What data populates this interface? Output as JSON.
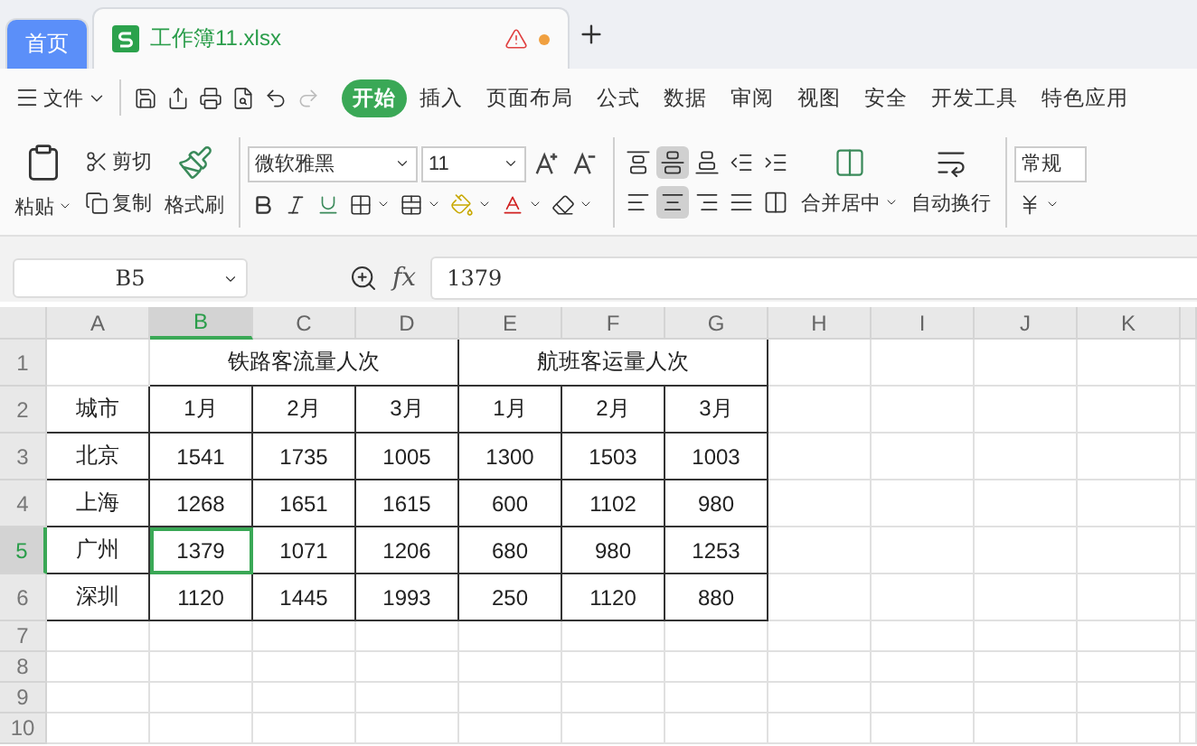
{
  "doc_tabs": [
    {
      "label": "首页",
      "selected": false,
      "kind": "home"
    },
    {
      "label": "工作簿11.xlsx",
      "selected": true,
      "kind": "file",
      "unsaved": true
    }
  ],
  "menu": {
    "file": "文件",
    "tabs": [
      {
        "label": "开始",
        "selected": true
      },
      {
        "label": "插入",
        "selected": false
      },
      {
        "label": "页面布局",
        "selected": false
      },
      {
        "label": "公式",
        "selected": false
      },
      {
        "label": "数据",
        "selected": false
      },
      {
        "label": "审阅",
        "selected": false
      },
      {
        "label": "视图",
        "selected": false
      },
      {
        "label": "安全",
        "selected": false
      },
      {
        "label": "开发工具",
        "selected": false
      },
      {
        "label": "特色应用",
        "selected": false
      }
    ]
  },
  "ribbon": {
    "paste": "粘贴",
    "cut": "剪切",
    "copy": "复制",
    "format_painter": "格式刷",
    "font_name": "微软雅黑",
    "font_size": "11",
    "align_buttons": [
      {
        "selected": false
      },
      {
        "selected": true
      },
      {
        "selected": false
      },
      {
        "selected": false
      },
      {
        "selected": false
      },
      {
        "selected": false
      },
      {
        "selected": true
      },
      {
        "selected": false
      },
      {
        "selected": false
      },
      {
        "selected": false
      }
    ],
    "merge": "合并居中",
    "wrap": "自动换行",
    "number_format": "常规"
  },
  "name_box": "B5",
  "formula_label": "fx",
  "formula": "1379",
  "columns": [
    {
      "label": "A",
      "selected": false
    },
    {
      "label": "B",
      "selected": true
    },
    {
      "label": "C",
      "selected": false
    },
    {
      "label": "D",
      "selected": false
    },
    {
      "label": "E",
      "selected": false
    },
    {
      "label": "F",
      "selected": false
    },
    {
      "label": "G",
      "selected": false
    },
    {
      "label": "H",
      "selected": false
    },
    {
      "label": "I",
      "selected": false
    },
    {
      "label": "J",
      "selected": false
    },
    {
      "label": "K",
      "selected": false
    }
  ],
  "rows": [
    {
      "header": "1",
      "selected": false,
      "cells": [
        {
          "bordered": false
        },
        {
          "text": "铁路客流量人次",
          "kind": "group",
          "bordered": true
        },
        {
          "text": "航班客运量人次",
          "kind": "group",
          "bordered": true
        }
      ]
    },
    {
      "header": "2",
      "selected": false,
      "cells": [
        {
          "text": "城市",
          "bordered": true
        },
        {
          "text": "1月",
          "bordered": true
        },
        {
          "text": "2月",
          "bordered": true
        },
        {
          "text": "3月",
          "bordered": true
        },
        {
          "text": "1月",
          "bordered": true
        },
        {
          "text": "2月",
          "bordered": true
        },
        {
          "text": "3月",
          "bordered": true
        }
      ]
    },
    {
      "header": "3",
      "selected": false,
      "cells": [
        {
          "text": "北京",
          "bordered": true
        },
        {
          "text": "1541",
          "bordered": true
        },
        {
          "text": "1735",
          "bordered": true
        },
        {
          "text": "1005",
          "bordered": true
        },
        {
          "text": "1300",
          "bordered": true
        },
        {
          "text": "1503",
          "bordered": true
        },
        {
          "text": "1003",
          "bordered": true
        }
      ]
    },
    {
      "header": "4",
      "selected": false,
      "cells": [
        {
          "text": "上海",
          "bordered": true
        },
        {
          "text": "1268",
          "bordered": true
        },
        {
          "text": "1651",
          "bordered": true
        },
        {
          "text": "1615",
          "bordered": true
        },
        {
          "text": "600",
          "bordered": true
        },
        {
          "text": "1102",
          "bordered": true
        },
        {
          "text": "980",
          "bordered": true
        }
      ]
    },
    {
      "header": "5",
      "selected": true,
      "cells": [
        {
          "text": "广州",
          "bordered": true
        },
        {
          "text": "1379",
          "bordered": true,
          "selected": true
        },
        {
          "text": "1071",
          "bordered": true
        },
        {
          "text": "1206",
          "bordered": true
        },
        {
          "text": "680",
          "bordered": true
        },
        {
          "text": "980",
          "bordered": true
        },
        {
          "text": "1253",
          "bordered": true
        }
      ]
    },
    {
      "header": "6",
      "selected": false,
      "cells": [
        {
          "text": "深圳",
          "bordered": true
        },
        {
          "text": "1120",
          "bordered": true
        },
        {
          "text": "1445",
          "bordered": true
        },
        {
          "text": "1993",
          "bordered": true
        },
        {
          "text": "250",
          "bordered": true
        },
        {
          "text": "1120",
          "bordered": true
        },
        {
          "text": "880",
          "bordered": true
        }
      ]
    },
    {
      "header": "7",
      "selected": false
    },
    {
      "header": "8",
      "selected": false
    },
    {
      "header": "9",
      "selected": false
    },
    {
      "header": "10",
      "selected": false
    }
  ]
}
